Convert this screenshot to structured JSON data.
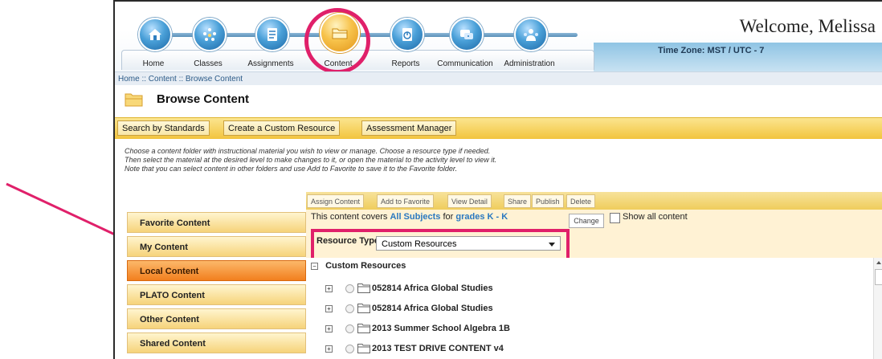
{
  "header": {
    "welcome": "Welcome, Melissa",
    "timezone": "Time Zone: MST / UTC - 7"
  },
  "nav": [
    {
      "label": "Home",
      "icon": "home-icon"
    },
    {
      "label": "Classes",
      "icon": "classes-icon"
    },
    {
      "label": "Assignments",
      "icon": "assignments-icon"
    },
    {
      "label": "Content",
      "icon": "content-folder-icon",
      "active": true
    },
    {
      "label": "Reports",
      "icon": "reports-icon"
    },
    {
      "label": "Communication",
      "icon": "communication-icon"
    },
    {
      "label": "Administration",
      "icon": "administration-icon"
    }
  ],
  "breadcrumb": "Home :: Content :: Browse Content",
  "page_title": "Browse Content",
  "tabs": [
    "Search by Standards",
    "Create a Custom Resource",
    "Assessment Manager"
  ],
  "instructions": [
    "Choose a content folder with instructional material you wish to view or manage. Choose a resource type if needed.",
    "Then select the material at the desired level to make changes to it, or open the material to the activity level to view it.",
    "Note that you can select content in other folders and use Add to Favorite to save it to the Favorite folder."
  ],
  "actions": [
    "Assign Content",
    "Add to Favorite",
    "View Detail",
    "Share",
    "Publish",
    "Delete"
  ],
  "left_menu": [
    {
      "label": "Favorite Content"
    },
    {
      "label": "My Content"
    },
    {
      "label": "Local Content",
      "active": true
    },
    {
      "label": "PLATO Content"
    },
    {
      "label": "Other Content"
    },
    {
      "label": "Shared Content"
    }
  ],
  "coverage": {
    "prefix": "This content covers ",
    "subjects": "All Subjects",
    "middle": "  for ",
    "grades": "grades K - K",
    "change": "Change",
    "show_all": "Show all content"
  },
  "resource_type": {
    "label": "Resource Type:",
    "value": "Custom Resources"
  },
  "tree": {
    "root": "Custom Resources",
    "items": [
      "052814 Africa Global Studies",
      "052814 Africa Global Studies",
      "2013 Summer School Algebra 1B",
      "2013 TEST DRIVE CONTENT v4"
    ]
  },
  "colors": {
    "annotation": "#e0206a",
    "tab_bar": "#f2c43e",
    "active_menu": "#f27f1e",
    "link": "#2a78c0"
  }
}
